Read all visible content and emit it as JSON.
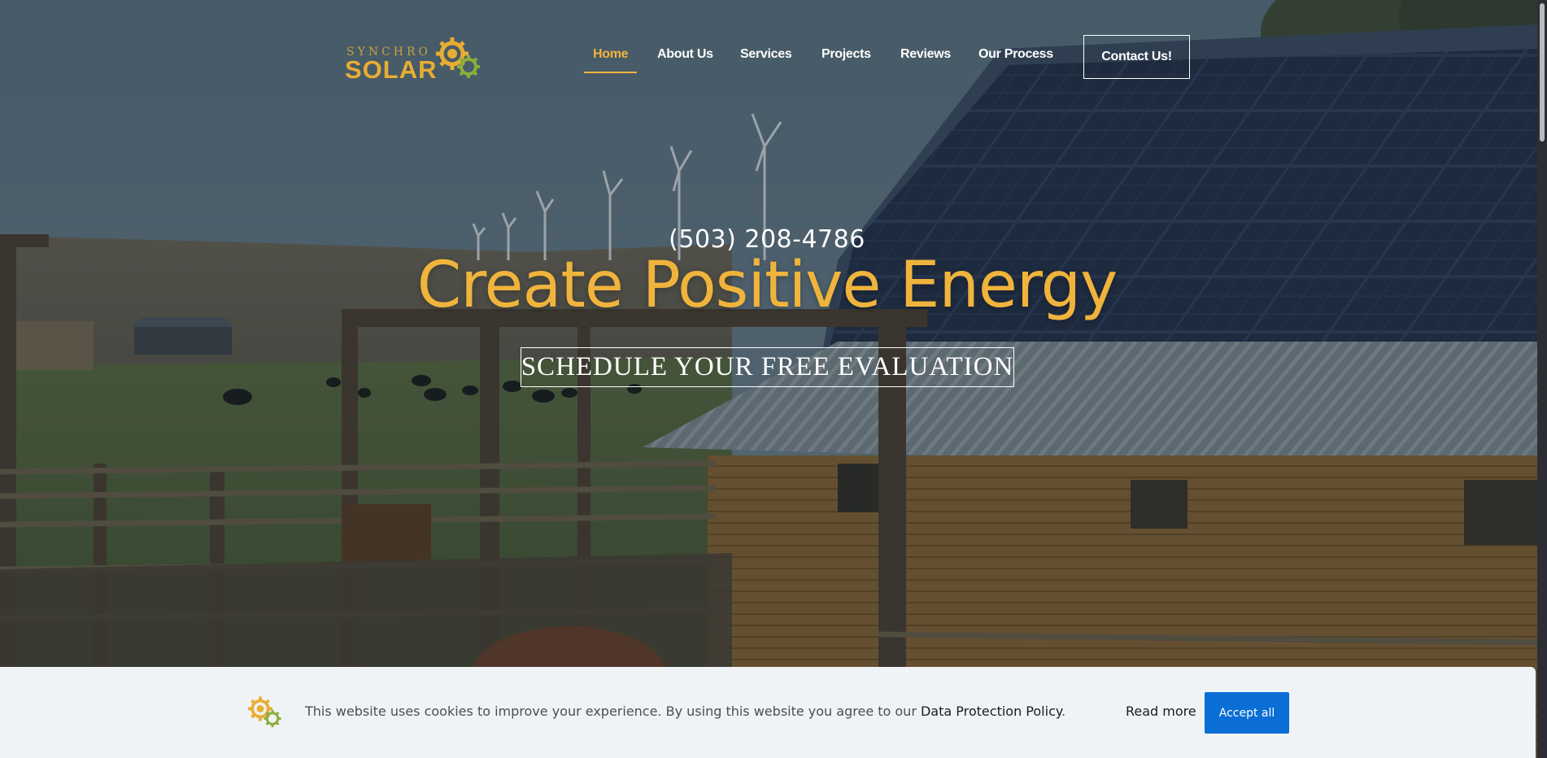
{
  "logo": {
    "line1": "SYNCHRO",
    "line2": "SOLAR"
  },
  "nav": {
    "items": [
      {
        "label": "Home",
        "active": true
      },
      {
        "label": "About Us"
      },
      {
        "label": "Services"
      },
      {
        "label": "Projects"
      },
      {
        "label": "Reviews"
      },
      {
        "label": "Our Process"
      }
    ],
    "contact_label": "Contact Us!"
  },
  "hero": {
    "phone": "(503) 208-4786",
    "headline": "Create Positive Energy",
    "cta_label": "SCHEDULE YOUR FREE EVALUATION"
  },
  "cookie": {
    "text": "This website uses cookies to improve your experience. By using this website you agree to our ",
    "policy_label": "Data Protection Policy",
    "period": ".",
    "read_more_label": "Read more",
    "accept_label": "Accept all"
  },
  "colors": {
    "accent": "#f0b43c",
    "button_blue": "#0a6ed6",
    "banner_bg": "#f0f3f5"
  },
  "icons": {
    "logo": "gear-sun-icon",
    "cookie": "gear-sun-icon"
  }
}
